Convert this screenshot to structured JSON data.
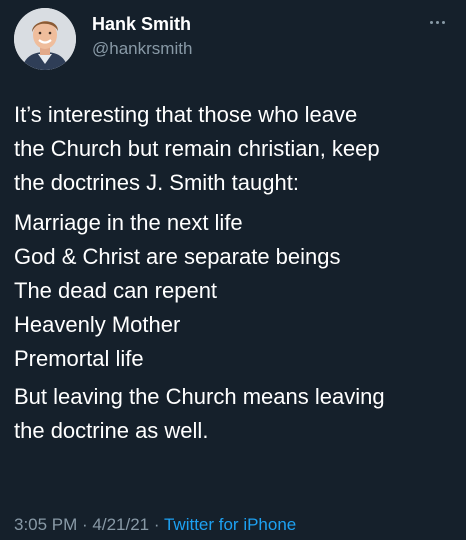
{
  "tweet": {
    "author": {
      "display_name": "Hank Smith",
      "handle": "@hankrsmith"
    },
    "more_icon": "more-dots-icon",
    "body": {
      "intro_lines": [
        "It’s interesting that those who leave",
        "the Church but remain christian, keep",
        "the doctrines J. Smith taught:"
      ],
      "list": [
        "Marriage in the next life",
        "God & Christ are separate beings",
        "The dead can repent",
        "Heavenly Mother",
        "Premortal life"
      ],
      "closing_lines": [
        "But leaving the Church means leaving",
        "the doctrine as well."
      ]
    },
    "meta": {
      "time": "3:05 PM",
      "separator_1": " · ",
      "date": "4/21/21",
      "separator_2": " · ",
      "source": "Twitter for iPhone"
    }
  },
  "colors": {
    "background": "#15202b",
    "text": "#ffffff",
    "secondary_text": "#8899a6",
    "link": "#1da1f2"
  }
}
